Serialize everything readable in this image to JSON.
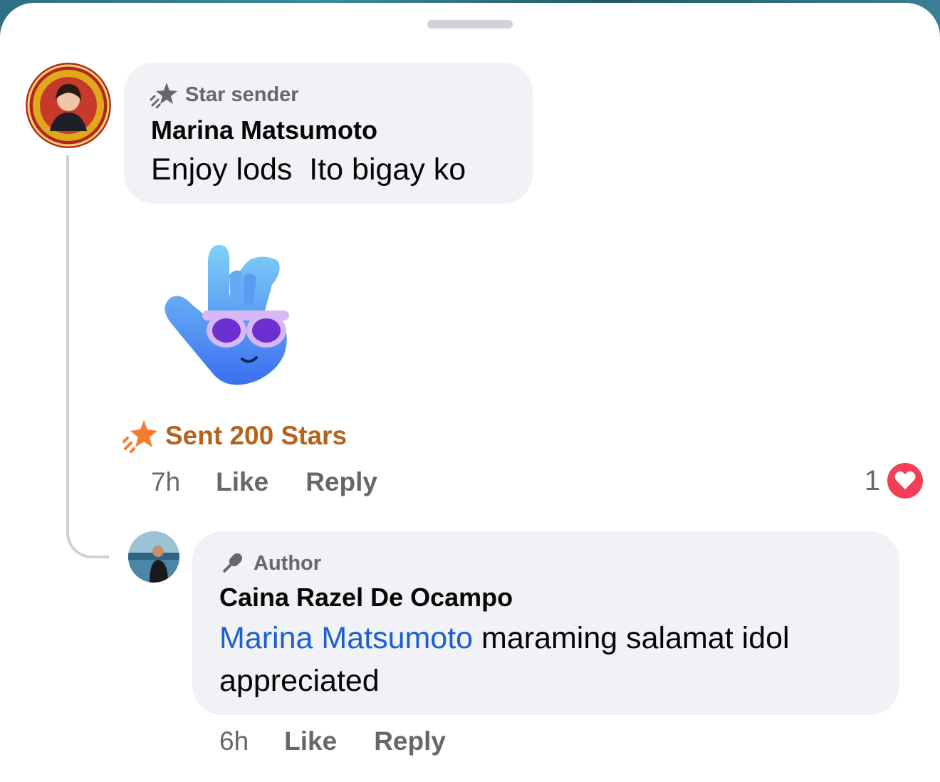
{
  "theme": {
    "sheet_bg": "#ffffff",
    "bubble_bg": "#f0f2f5",
    "mention_color": "#1b5fd1",
    "stars_color": "#b5621b",
    "star_icon_color": "#f57c2f",
    "heart_color": "#f33e58",
    "meta_color": "#65676b"
  },
  "comments": [
    {
      "badge": "Star sender",
      "badge_icon": "star-sender-icon",
      "author": "Marina Matsumoto",
      "text": "Enjoy lods  Ito bigay ko",
      "sticker": "rock-hand-sunglasses-sticker",
      "stars_label": "Sent 200 Stars",
      "time": "7h",
      "like_label": "Like",
      "reply_label": "Reply",
      "reaction_count": "1",
      "reaction_type": "heart-icon"
    },
    {
      "badge": "Author",
      "badge_icon": "microphone-icon",
      "author": "Caina Razel De Ocampo",
      "mention": "Marina Matsumoto",
      "text": " maraming salamat idol appreciated",
      "time": "6h",
      "like_label": "Like",
      "reply_label": "Reply"
    }
  ]
}
